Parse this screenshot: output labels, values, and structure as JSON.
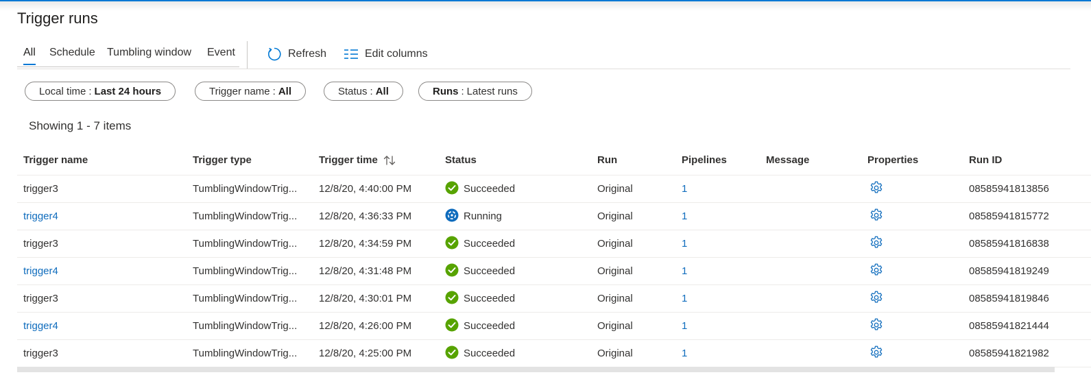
{
  "page": {
    "title": "Trigger runs"
  },
  "tabs": [
    {
      "label": "All",
      "active": true
    },
    {
      "label": "Schedule",
      "active": false
    },
    {
      "label": "Tumbling window",
      "active": false
    },
    {
      "label": "Event",
      "active": false
    }
  ],
  "toolbar": {
    "refresh_label": "Refresh",
    "edit_columns_label": "Edit columns"
  },
  "filters": [
    {
      "key": "Local time",
      "value": "Last 24 hours"
    },
    {
      "key": "Trigger name",
      "value": "All"
    },
    {
      "key": "Status",
      "value": "All"
    },
    {
      "key": "Runs",
      "value": "Latest runs"
    }
  ],
  "showing_text": "Showing 1 - 7 items",
  "columns": {
    "trigger_name": "Trigger name",
    "trigger_type": "Trigger type",
    "trigger_time": "Trigger time",
    "status": "Status",
    "run": "Run",
    "pipelines": "Pipelines",
    "message": "Message",
    "properties": "Properties",
    "run_id": "Run ID"
  },
  "rows": [
    {
      "trigger_name": "trigger3",
      "name_is_link": false,
      "trigger_type": "TumblingWindowTrig...",
      "trigger_time": "12/8/20, 4:40:00 PM",
      "status": "Succeeded",
      "run": "Original",
      "pipelines": "1",
      "message": "",
      "run_id": "08585941813856"
    },
    {
      "trigger_name": "trigger4",
      "name_is_link": true,
      "trigger_type": "TumblingWindowTrig...",
      "trigger_time": "12/8/20, 4:36:33 PM",
      "status": "Running",
      "run": "Original",
      "pipelines": "1",
      "message": "",
      "run_id": "08585941815772"
    },
    {
      "trigger_name": "trigger3",
      "name_is_link": false,
      "trigger_type": "TumblingWindowTrig...",
      "trigger_time": "12/8/20, 4:34:59 PM",
      "status": "Succeeded",
      "run": "Original",
      "pipelines": "1",
      "message": "",
      "run_id": "08585941816838"
    },
    {
      "trigger_name": "trigger4",
      "name_is_link": true,
      "trigger_type": "TumblingWindowTrig...",
      "trigger_time": "12/8/20, 4:31:48 PM",
      "status": "Succeeded",
      "run": "Original",
      "pipelines": "1",
      "message": "",
      "run_id": "08585941819249"
    },
    {
      "trigger_name": "trigger3",
      "name_is_link": false,
      "trigger_type": "TumblingWindowTrig...",
      "trigger_time": "12/8/20, 4:30:01 PM",
      "status": "Succeeded",
      "run": "Original",
      "pipelines": "1",
      "message": "",
      "run_id": "08585941819846"
    },
    {
      "trigger_name": "trigger4",
      "name_is_link": true,
      "trigger_type": "TumblingWindowTrig...",
      "trigger_time": "12/8/20, 4:26:00 PM",
      "status": "Succeeded",
      "run": "Original",
      "pipelines": "1",
      "message": "",
      "run_id": "08585941821444"
    },
    {
      "trigger_name": "trigger3",
      "name_is_link": false,
      "trigger_type": "TumblingWindowTrig...",
      "trigger_time": "12/8/20, 4:25:00 PM",
      "status": "Succeeded",
      "run": "Original",
      "pipelines": "1",
      "message": "",
      "run_id": "08585941821982"
    }
  ],
  "icons": {
    "refresh": "refresh-icon",
    "edit_columns": "edit-columns-icon",
    "sort": "sort-icon",
    "succeeded": "check-circle-icon",
    "running": "running-icon",
    "properties": "gear-icon"
  },
  "colors": {
    "accent": "#0078d4",
    "link": "#0f6cbd",
    "success": "#57a300",
    "running": "#0f6cbd"
  }
}
